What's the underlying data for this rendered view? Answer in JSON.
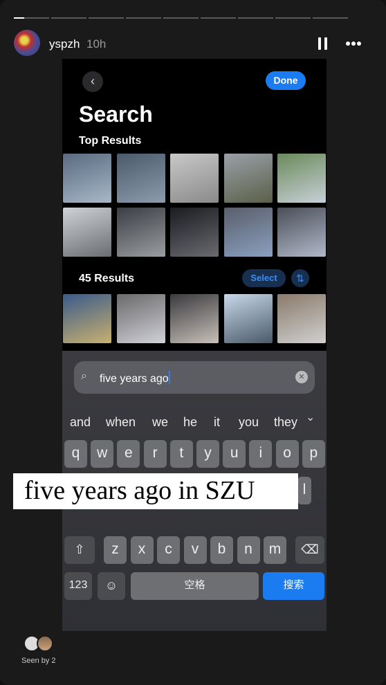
{
  "story": {
    "progress_segments": 9,
    "active_segment_progress": 0.3,
    "username": "yspzh",
    "time_ago": "10h",
    "pause_icon": "pause-icon",
    "more_icon": "more-icon",
    "caption": "five years ago in SZU",
    "seen_by": "Seen by 2"
  },
  "photos_app": {
    "back_icon": "chevron-left-icon",
    "done_label": "Done",
    "title": "Search",
    "top_results_label": "Top Results",
    "results_count_label": "45 Results",
    "select_label": "Select",
    "sort_icon": "sort-arrows-icon",
    "search_value": "five years ago",
    "accent": "#1a7cf0"
  },
  "keyboard": {
    "suggestions": [
      "and",
      "when",
      "we",
      "he",
      "it",
      "you",
      "they"
    ],
    "row1": [
      "q",
      "w",
      "e",
      "r",
      "t",
      "y",
      "u",
      "i",
      "o",
      "p"
    ],
    "row2_visible": [
      "l"
    ],
    "row3": [
      "z",
      "x",
      "c",
      "v",
      "b",
      "n",
      "m"
    ],
    "numbers_label": "123",
    "space_label": "空格",
    "search_label": "搜索"
  }
}
